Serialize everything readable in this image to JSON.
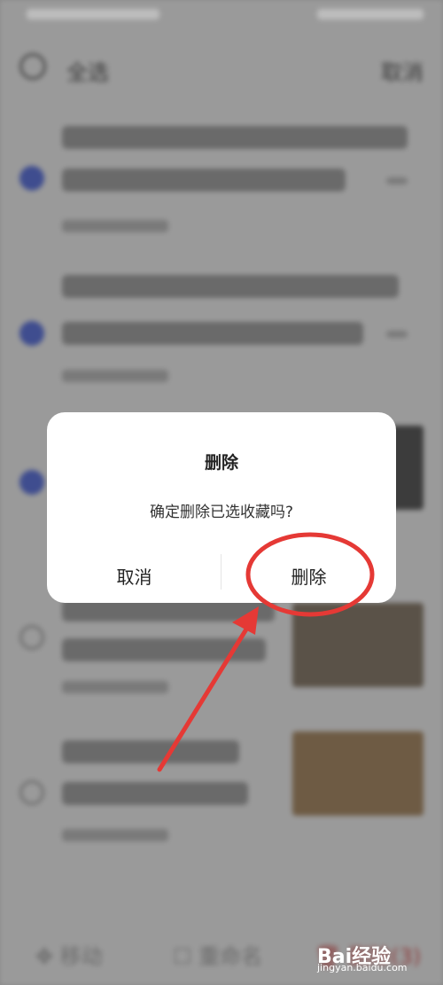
{
  "header": {
    "select_all": "全选",
    "cancel": "取消"
  },
  "dialog": {
    "title": "删除",
    "message": "确定删除已选收藏吗?",
    "cancel_label": "取消",
    "delete_label": "删除"
  },
  "bottom_bar": {
    "move": "移动",
    "rename": "重命名",
    "delete": "删除(3)"
  },
  "watermark": {
    "brand": "Bai经验",
    "url": "jingyan.baidu.com"
  },
  "colors": {
    "checkbox_selected": "#3f4d8f",
    "annotation": "#e53935",
    "dialog_bg": "#ffffff",
    "overlay": "#8a8a8a"
  }
}
